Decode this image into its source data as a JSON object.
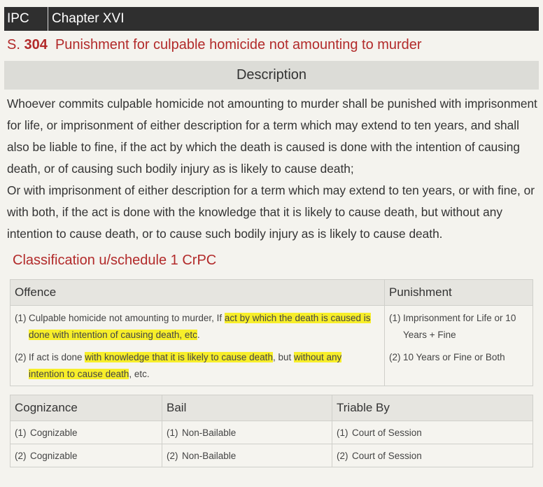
{
  "header": {
    "act": "IPC",
    "chapter": "Chapter XVI"
  },
  "section": {
    "prefix": "S.",
    "number": "304",
    "title": "Punishment for culpable homicide not amounting to murder"
  },
  "description": {
    "heading": "Description",
    "para1": "Whoever commits culpable homicide not amounting to murder shall be punished with imprisonment for life, or imprisonment of either description for a term which may extend to ten years, and shall also be liable to fine, if the act by which the death is caused is done with the intention of causing death, or of causing such bodily injury as is likely to cause death;",
    "para2": "Or with imprisonment of either description for a term which may extend to ten years, or with fine, or with both, if the act is done with the knowledge that it is likely to cause death, but without any intention to cause death, or to cause such bodily injury as is likely to cause death."
  },
  "classification": {
    "heading": "Classification u/schedule 1 CrPC",
    "offence_header": "Offence",
    "punishment_header": "Punishment",
    "offences": [
      {
        "idx": "(1)",
        "pre": "Culpable homicide not amounting to murder, If ",
        "hl1": "act by which the death is caused is done with intention of causing death, etc",
        "mid": "",
        "hl2": "",
        "post": "."
      },
      {
        "idx": "(2)",
        "pre": "If act is done ",
        "hl1": "with knowledge that it is likely to cause death",
        "mid": ", but ",
        "hl2": "without any intention to cause death",
        "post": ", etc."
      }
    ],
    "punishments": [
      {
        "idx": "(1)",
        "text": "Imprisonment for Life or 10 Years + Fine"
      },
      {
        "idx": "(2)",
        "text": "10 Years or Fine or Both"
      }
    ],
    "columns": {
      "cognizance": "Cognizance",
      "bail": "Bail",
      "triable": "Triable By"
    },
    "rows": [
      {
        "idx": "(1)",
        "cognizance": "Cognizable",
        "bail": "Non-Bailable",
        "triable": "Court of Session"
      },
      {
        "idx": "(2)",
        "cognizance": "Cognizable",
        "bail": "Non-Bailable",
        "triable": "Court of Session"
      }
    ]
  }
}
